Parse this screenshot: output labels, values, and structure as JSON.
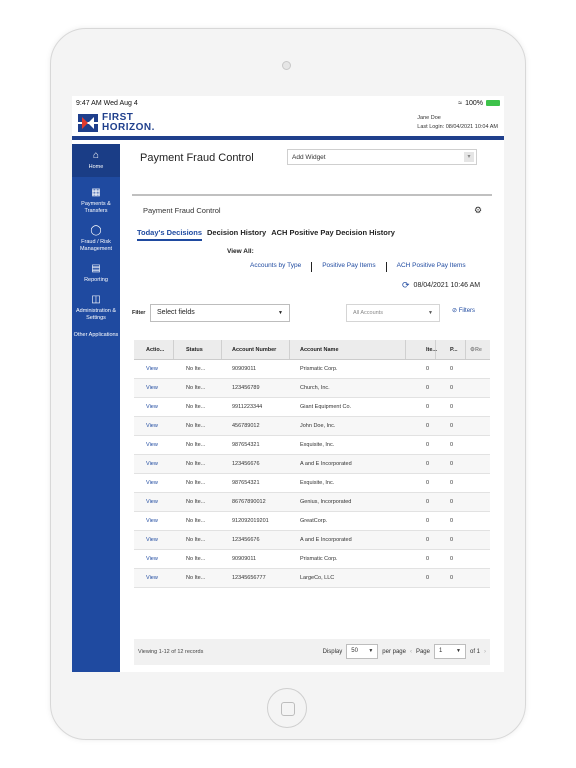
{
  "status_bar": {
    "time": "9:47 AM",
    "date": "Wed Aug 4",
    "battery": "100%"
  },
  "brand": {
    "line1": "FIRST",
    "line2": "HORIZON."
  },
  "user": {
    "name": "Jane Doe",
    "last_login": "Last Login: 08/04/2021 10:04 AM"
  },
  "sidebar": {
    "items": [
      {
        "label": "Home",
        "icon": "home-icon"
      },
      {
        "label": "Payments & Transfers",
        "icon": "payments-icon"
      },
      {
        "label": "Fraud / Risk Management",
        "icon": "shield-icon"
      },
      {
        "label": "Reporting",
        "icon": "report-icon"
      },
      {
        "label": "Administration & Settings",
        "icon": "admin-icon"
      },
      {
        "label": "Other Applications",
        "icon": ""
      }
    ]
  },
  "main": {
    "title": "Payment Fraud Control",
    "widget_select": "Add Widget",
    "panel_title": "Payment Fraud Control",
    "tabs": [
      "Today's Decisions",
      "Decision History",
      "ACH Positive Pay Decision History"
    ],
    "view_all": "View All:",
    "links": [
      "Accounts by Type",
      "Positive Pay Items",
      "ACH Positive Pay Items"
    ],
    "datetime": "08/04/2021 10:46 AM",
    "filter_label": "Filter",
    "filter_select": "Select fields",
    "accounts_select": "All Accounts",
    "filters_button": "Filters"
  },
  "table": {
    "headers": [
      "Actio...",
      "Status",
      "Account Number",
      "Account Name",
      "Ite...",
      "P...",
      "Re"
    ],
    "rows": [
      [
        "View",
        "No Ite...",
        "90909011",
        "Prismatic Corp.",
        "0",
        "0"
      ],
      [
        "View",
        "No Ite...",
        "123456789",
        "Church, Inc.",
        "0",
        "0"
      ],
      [
        "View",
        "No Ite...",
        "9911223344",
        "Giant Equipment Co.",
        "0",
        "0"
      ],
      [
        "View",
        "No Ite...",
        "456789012",
        "John Doe, Inc.",
        "0",
        "0"
      ],
      [
        "View",
        "No Ite...",
        "987654321",
        "Exquisite, Inc.",
        "0",
        "0"
      ],
      [
        "View",
        "No Ite...",
        "123456676",
        "A and E Incorporated",
        "0",
        "0"
      ],
      [
        "View",
        "No Ite...",
        "987654321",
        "Exquisite, Inc.",
        "0",
        "0"
      ],
      [
        "View",
        "No Ite...",
        "86767890012",
        "Genius, Incorporated",
        "0",
        "0"
      ],
      [
        "View",
        "No Ite...",
        "912092019201",
        "GreatCorp.",
        "0",
        "0"
      ],
      [
        "View",
        "No Ite...",
        "123456676",
        "A and E Incorporated",
        "0",
        "0"
      ],
      [
        "View",
        "No Ite...",
        "90909011",
        "Prismatic Corp.",
        "0",
        "0"
      ],
      [
        "View",
        "No Ite...",
        "12345656777",
        "LargeCo, LLC",
        "0",
        "0"
      ]
    ],
    "footer_text": "Viewing 1-12 of 12 records",
    "display_label": "Display",
    "per_page_value": "50",
    "per_page_label": "per page",
    "page_label": "Page",
    "page_value": "1",
    "of_label": "of 1"
  },
  "colors": {
    "brand_blue": "#1f4aa0",
    "sidebar": "#1f4aa0"
  }
}
